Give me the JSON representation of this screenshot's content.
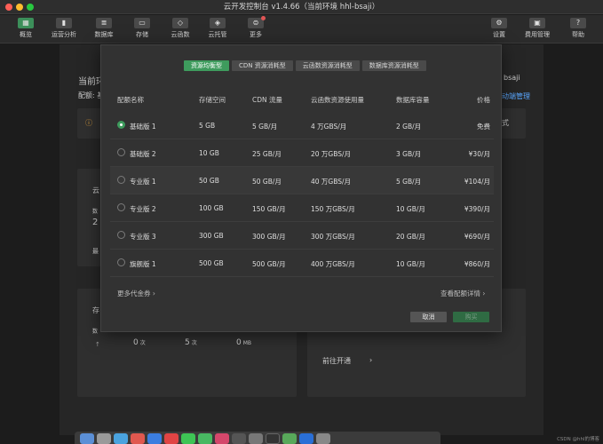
{
  "window": {
    "title": "云开发控制台 v1.4.66（当前环境 hhl-bsaji）"
  },
  "toolbar": {
    "items": [
      {
        "label": "概览",
        "icon": "overview-icon",
        "active": true
      },
      {
        "label": "运营分析",
        "icon": "analytics-icon"
      },
      {
        "label": "数据库",
        "icon": "database-icon"
      },
      {
        "label": "存储",
        "icon": "storage-icon"
      },
      {
        "label": "云函数",
        "icon": "function-icon"
      },
      {
        "label": "云托管",
        "icon": "cloud-hosting-icon"
      },
      {
        "label": "更多",
        "icon": "more-icon",
        "badge": true
      },
      {
        "label": "设置",
        "icon": "settings-icon"
      },
      {
        "label": "费用管理",
        "icon": "billing-icon"
      },
      {
        "label": "帮助",
        "icon": "help-icon"
      }
    ]
  },
  "background": {
    "env_heading": "当前环",
    "config_label": "配额: 基",
    "env_id": "bsaji",
    "manage_link": "动端管理",
    "mode_text": "式",
    "card_title": "云",
    "card_sub": "数",
    "card_value": "2",
    "card_last": "最",
    "storage_title": "存",
    "storage_sub": "数",
    "stats": [
      {
        "value": "0",
        "unit": "次"
      },
      {
        "value": "5",
        "unit": "次"
      },
      {
        "value": "0",
        "unit": "MB"
      }
    ],
    "open_link": "前往开通"
  },
  "modal": {
    "tabs": [
      "资源均衡型",
      "CDN 资源消耗型",
      "云函数资源消耗型",
      "数据库资源消耗型"
    ],
    "columns": [
      "配额名称",
      "存储空间",
      "CDN 流量",
      "云函数资源使用量",
      "数据库容量",
      "价格"
    ],
    "rows": [
      {
        "name": "基础版 1",
        "storage": "5 GB",
        "cdn": "5 GB/月",
        "func": "4 万GBS/月",
        "db": "2 GB/月",
        "price": "免费",
        "selected": true
      },
      {
        "name": "基础版 2",
        "storage": "10 GB",
        "cdn": "25 GB/月",
        "func": "20 万GBS/月",
        "db": "3 GB/月",
        "price": "¥30/月"
      },
      {
        "name": "专业版 1",
        "storage": "50 GB",
        "cdn": "50 GB/月",
        "func": "40 万GBS/月",
        "db": "5 GB/月",
        "price": "¥104/月"
      },
      {
        "name": "专业版 2",
        "storage": "100 GB",
        "cdn": "150 GB/月",
        "func": "150 万GBS/月",
        "db": "10 GB/月",
        "price": "¥390/月"
      },
      {
        "name": "专业版 3",
        "storage": "300 GB",
        "cdn": "300 GB/月",
        "func": "300 万GBS/月",
        "db": "20 GB/月",
        "price": "¥690/月"
      },
      {
        "name": "旗舰版 1",
        "storage": "500 GB",
        "cdn": "500 GB/月",
        "func": "400 万GBS/月",
        "db": "10 GB/月",
        "price": "¥860/月"
      }
    ],
    "more_vouchers": "更多代金券 ›",
    "view_details": "查看配额详情 ›",
    "cancel": "取消",
    "confirm": "购买"
  },
  "watermark": "CSDN @hhl的博客",
  "colors": {
    "accent": "#3e9b5d",
    "bg": "#1c1c1c",
    "modal": "#323232"
  }
}
